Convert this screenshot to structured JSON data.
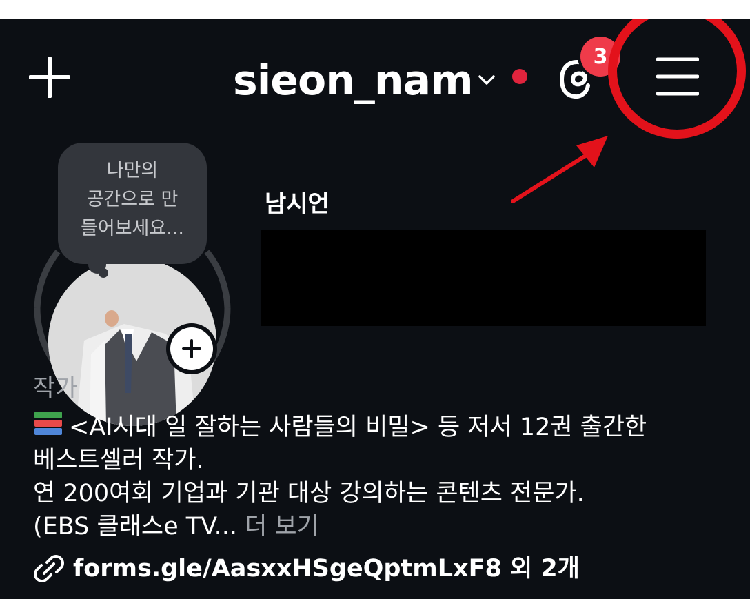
{
  "header": {
    "username": "sieon_nam",
    "notification_badge": "3",
    "online_dot_color": "#e0243d",
    "icons": [
      "plus-icon",
      "chevron-down-icon",
      "threads-icon",
      "hamburger-menu-icon"
    ]
  },
  "profile": {
    "note_bubble": "나만의\n공간으로 만\n들어보세요...",
    "display_name": "남시언",
    "category": "작가",
    "bio": {
      "line1": "<AI시대 일 잘하는 사람들의 비밀> 등 저서 12권 출간한",
      "line2": "베스트셀러 작가.",
      "line3": "연 200여회 기업과 기관 대상 강의하는 콘텐츠 전문가.",
      "line4": "(EBS 클래스e TV...",
      "more_label": "더 보기"
    },
    "link": "forms.gle/AasxxHSgeQptmLxF8 외 2개"
  },
  "annotation": {
    "highlight_color": "#e3121b"
  }
}
